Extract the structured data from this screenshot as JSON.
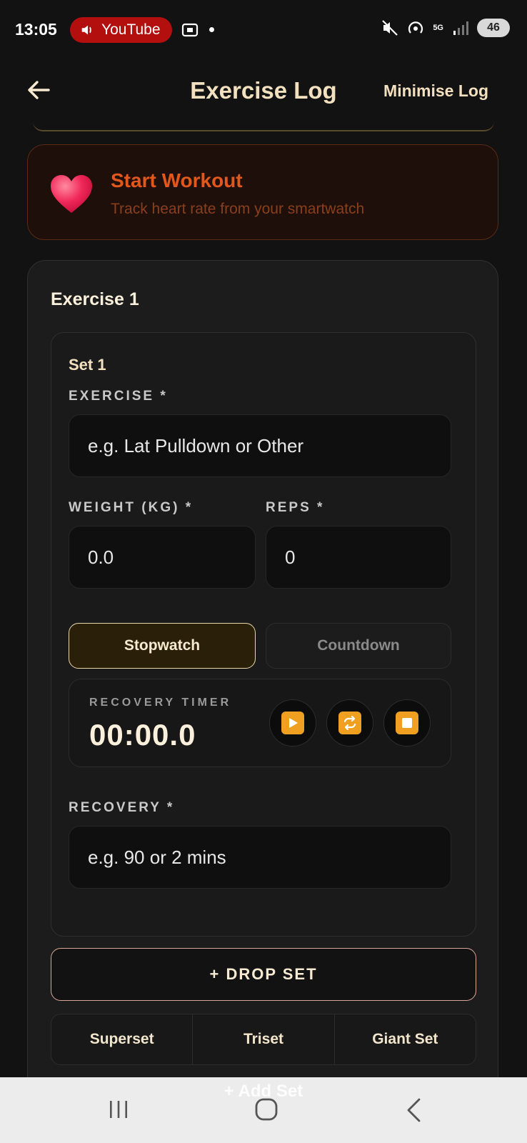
{
  "status_bar": {
    "time": "13:05",
    "media_app": "YouTube",
    "network": "5G",
    "battery": "46"
  },
  "header": {
    "title": "Exercise Log",
    "minimise_label": "Minimise Log"
  },
  "workout_card": {
    "title": "Start Workout",
    "subtitle": "Track heart rate from your smartwatch",
    "icon": "heart-icon"
  },
  "exercise": {
    "title": "Exercise 1",
    "set": {
      "title": "Set 1",
      "exercise_label": "EXERCISE *",
      "exercise_placeholder": "e.g. Lat Pulldown or Other",
      "weight_label": "WEIGHT (KG) *",
      "weight_value": "0.0",
      "reps_label": "REPS *",
      "reps_value": "0",
      "timer_modes": [
        "Stopwatch",
        "Countdown"
      ],
      "active_timer_mode": "Stopwatch",
      "recovery_timer_label": "RECOVERY TIMER",
      "recovery_timer_value": "00:00.0",
      "timer_controls": [
        "play-icon",
        "repeat-icon",
        "stop-icon"
      ],
      "recovery_label": "RECOVERY *",
      "recovery_placeholder": "e.g. 90 or 2 mins"
    },
    "drop_set_label": "+ DROP SET",
    "set_types": [
      "Superset",
      "Triset",
      "Giant Set"
    ],
    "add_set_label": "+ Add Set"
  },
  "colors": {
    "accent_orange": "#e2581c",
    "timer_control": "#f0a020",
    "active_toggle_border": "#e8d9a8",
    "background": "#121212"
  }
}
